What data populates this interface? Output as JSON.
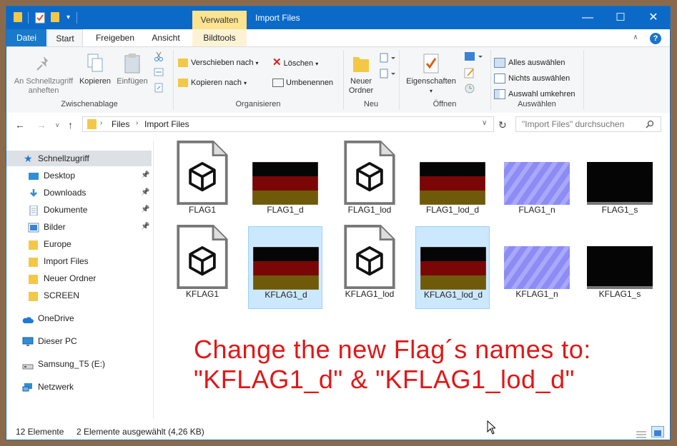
{
  "window": {
    "title": "Import Files",
    "context_tab": "Verwalten",
    "controls": {
      "minimize": "—",
      "maximize": "☐",
      "close": "✕"
    }
  },
  "menu_tabs": {
    "datei": "Datei",
    "start": "Start",
    "freigeben": "Freigeben",
    "ansicht": "Ansicht",
    "bildtools": "Bildtools"
  },
  "ribbon": {
    "clipboard": {
      "pin_quick": "An Schnellzugriff anheften",
      "copy": "Kopieren",
      "paste": "Einfügen",
      "group": "Zwischenablage"
    },
    "organize": {
      "move_to": "Verschieben nach",
      "copy_to": "Kopieren nach",
      "delete": "Löschen",
      "rename": "Umbenennen",
      "group": "Organisieren"
    },
    "new": {
      "new_folder": "Neuer Ordner",
      "group": "Neu"
    },
    "open": {
      "properties": "Eigenschaften",
      "group": "Öffnen"
    },
    "select": {
      "select_all": "Alles auswählen",
      "select_none": "Nichts auswählen",
      "invert": "Auswahl umkehren",
      "group": "Auswählen"
    }
  },
  "address": {
    "crumbs": [
      "Files",
      "Import Files"
    ],
    "search_placeholder": "\"Import Files\" durchsuchen"
  },
  "nav_pane": {
    "quick_access": "Schnellzugriff",
    "items": [
      {
        "label": "Desktop",
        "icon": "desktop-icon",
        "pinned": true
      },
      {
        "label": "Downloads",
        "icon": "downloads-icon",
        "pinned": true
      },
      {
        "label": "Dokumente",
        "icon": "documents-icon",
        "pinned": true
      },
      {
        "label": "Bilder",
        "icon": "pictures-icon",
        "pinned": true
      },
      {
        "label": "Europe",
        "icon": "folder-icon",
        "pinned": false
      },
      {
        "label": "Import Files",
        "icon": "folder-icon",
        "pinned": false
      },
      {
        "label": "Neuer Ordner",
        "icon": "folder-icon",
        "pinned": false
      },
      {
        "label": "SCREEN",
        "icon": "folder-icon",
        "pinned": false
      }
    ],
    "onedrive": "OneDrive",
    "this_pc": "Dieser PC",
    "drive": "Samsung_T5 (E:)",
    "network": "Netzwerk"
  },
  "files": [
    {
      "name": "FLAG1",
      "kind": "model",
      "selected": false
    },
    {
      "name": "FLAG1_d",
      "kind": "flag",
      "selected": false
    },
    {
      "name": "FLAG1_lod",
      "kind": "model",
      "selected": false
    },
    {
      "name": "FLAG1_lod_d",
      "kind": "flag",
      "selected": false
    },
    {
      "name": "FLAG1_n",
      "kind": "normal",
      "selected": false
    },
    {
      "name": "FLAG1_s",
      "kind": "black",
      "selected": false
    },
    {
      "name": "KFLAG1",
      "kind": "model",
      "selected": false
    },
    {
      "name": "KFLAG1_d",
      "kind": "flag",
      "selected": true
    },
    {
      "name": "KFLAG1_lod",
      "kind": "model",
      "selected": false
    },
    {
      "name": "KFLAG1_lod_d",
      "kind": "flag",
      "selected": true
    },
    {
      "name": "KFLAG1_n",
      "kind": "normal",
      "selected": false
    },
    {
      "name": "KFLAG1_s",
      "kind": "black",
      "selected": false
    }
  ],
  "annotation": {
    "line1": "Change the new Flag´s names to:",
    "line2": "\"KFLAG1_d\" & \"KFLAG1_lod_d\""
  },
  "status": {
    "count": "12 Elemente",
    "selection": "2 Elemente ausgewählt (4,26 KB)"
  },
  "colors": {
    "titlebar": "#0b6ac8",
    "context_tab": "#fbe38f",
    "selection": "#cce8ff",
    "annotation": "#e01818"
  }
}
